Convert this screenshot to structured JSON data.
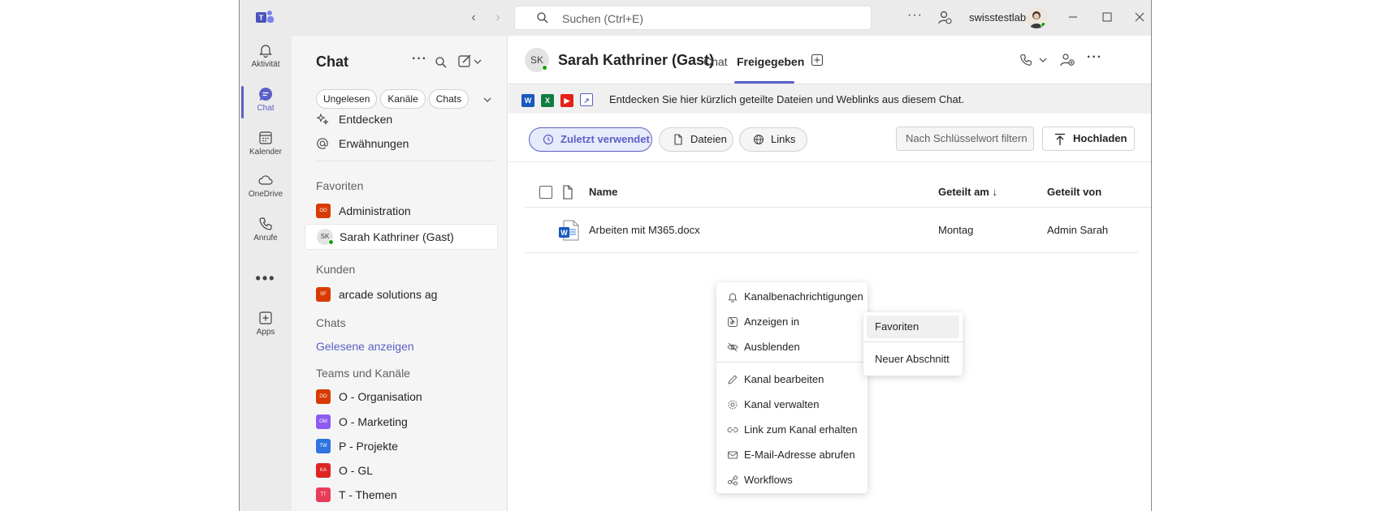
{
  "titlebar": {
    "search_placeholder": "Suchen (Ctrl+E)",
    "tenant": "swisstestlab"
  },
  "rail": {
    "items": [
      {
        "label": "Aktivität",
        "icon": "bell-icon"
      },
      {
        "label": "Chat",
        "icon": "chat-icon"
      },
      {
        "label": "Kalender",
        "icon": "calendar-icon"
      },
      {
        "label": "OneDrive",
        "icon": "cloud-icon"
      },
      {
        "label": "Anrufe",
        "icon": "phone-icon"
      },
      {
        "label": "Apps",
        "icon": "apps-icon"
      }
    ],
    "more": "•••"
  },
  "pane": {
    "title": "Chat",
    "filters": [
      "Ungelesen",
      "Kanäle",
      "Chats"
    ],
    "discover": "Entdecken",
    "mentions": "Erwähnungen",
    "favorites_header": "Favoriten",
    "favorites": [
      {
        "label": "Administration",
        "badge": "OO",
        "color": "#d83b01"
      },
      {
        "label": "Sarah Kathriner (Gast)",
        "badge": "SK"
      }
    ],
    "customers_header": "Kunden",
    "customers": [
      {
        "label": "arcade solutions ag",
        "badge": "SF",
        "color": "#d83b01"
      }
    ],
    "chats_header": "Chats",
    "show_read": "Gelesene anzeigen",
    "teams_header": "Teams und Kanäle",
    "teams": [
      {
        "label": "O - Organisation",
        "badge": "OO",
        "color": "#d83b01"
      },
      {
        "label": "O - Marketing",
        "badge": "OM",
        "color": "#8c5cf2"
      },
      {
        "label": "P - Projekte",
        "badge": "TW",
        "color": "#2f74e0"
      },
      {
        "label": "O - GL",
        "badge": "KA",
        "color": "#e02424"
      },
      {
        "label": "T - Themen",
        "badge": "TT",
        "color": "#e83d5a"
      }
    ]
  },
  "header": {
    "initials": "SK",
    "name": "Sarah Kathriner (Gast)",
    "tabs": [
      "Chat",
      "Freigegeben"
    ]
  },
  "banner": {
    "text": "Entdecken Sie hier kürzlich geteilte Dateien und Weblinks aus diesem Chat."
  },
  "toolbar": {
    "recent": "Zuletzt verwendet",
    "files": "Dateien",
    "links": "Links",
    "filter_placeholder": "Nach Schlüsselwort filtern",
    "upload": "Hochladen"
  },
  "table": {
    "columns": [
      "Name",
      "Geteilt am",
      "Geteilt von"
    ],
    "rows": [
      {
        "name": "Arbeiten mit M365.docx",
        "date": "Montag",
        "by": "Admin Sarah"
      }
    ]
  },
  "context_menu": {
    "items": [
      "Kanalbenachrichtigungen",
      "Anzeigen in",
      "Ausblenden",
      "Kanal bearbeiten",
      "Kanal verwalten",
      "Link zum Kanal erhalten",
      "E-Mail-Adresse abrufen",
      "Workflows"
    ],
    "submenu": [
      "Favoriten",
      "Neuer Abschnitt"
    ]
  },
  "colors": {
    "accent": "#5b5fc7",
    "presence": "#13a10e"
  }
}
